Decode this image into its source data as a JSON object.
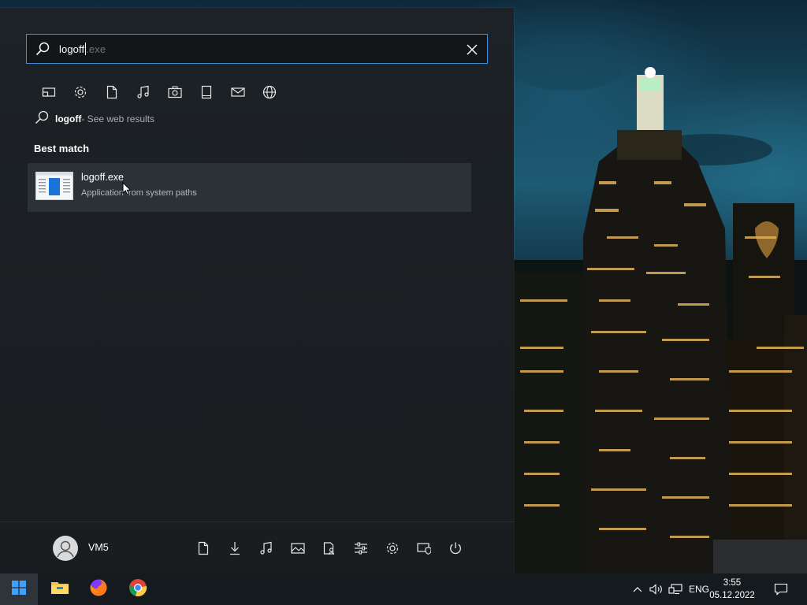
{
  "search": {
    "typed": "logoff",
    "suggestion": ".exe"
  },
  "filters": [
    {
      "name": "apps"
    },
    {
      "name": "settings"
    },
    {
      "name": "documents"
    },
    {
      "name": "music"
    },
    {
      "name": "photos"
    },
    {
      "name": "videos"
    },
    {
      "name": "email"
    },
    {
      "name": "web"
    }
  ],
  "web_result": {
    "query": "logoff",
    "suffix": " - See web results"
  },
  "best_match": {
    "heading": "Best match",
    "item": {
      "title": "logoff.exe",
      "subtitle": "Application from system paths"
    }
  },
  "user": {
    "name": "VM5"
  },
  "quick_links": [
    "documents",
    "downloads",
    "music",
    "pictures",
    "user-folder",
    "settings-sliders",
    "settings",
    "windows-security",
    "power"
  ],
  "taskbar": {
    "apps": [
      "file-explorer",
      "firefox",
      "chrome"
    ],
    "language": "ENG",
    "time": "3:55",
    "date": "05.12.2022"
  },
  "colors": {
    "accent_border": "#3f8fd8",
    "panel_bg": "#1b1f23",
    "selected_bg": "#2b3237"
  }
}
